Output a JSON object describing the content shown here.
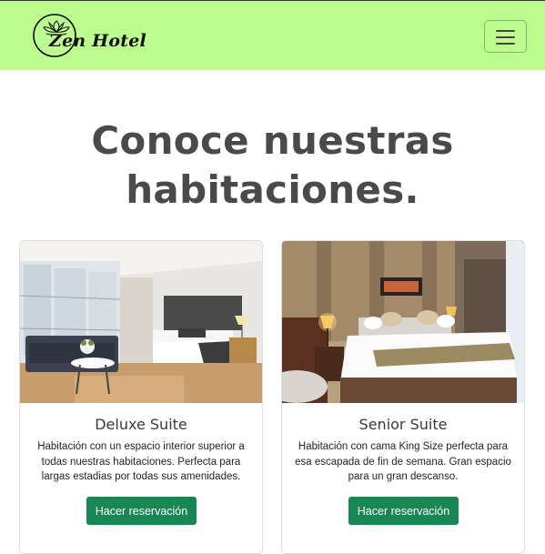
{
  "navbar": {
    "brand_name": "Zen Hotel",
    "logo_icon": "lotus-icon",
    "menu_icon": "hamburger-menu-icon",
    "background": "#bdfd8f"
  },
  "main": {
    "heading_line1": "Conoce nuestras",
    "heading_line2": "habitaciones."
  },
  "rooms": [
    {
      "title": "Deluxe Suite",
      "description": "Habitación con un espacio interior superior a todas nuestras habitaciones. Perfecta para largas estadias por todas sus amenidades.",
      "button_label": "Hacer reservación",
      "image": "bright-modern-hotel-room-photo"
    },
    {
      "title": "Senior Suite",
      "description": "Habitación con cama King Size perfecta para esa escapada de fin de semana. Gran espacio para un gran descanso.",
      "button_label": "Hacer reservación",
      "image": "warm-hotel-room-photo"
    }
  ],
  "colors": {
    "navbar_bg": "#bdfd8f",
    "button_bg": "#198754",
    "heading": "#4a4a4a"
  }
}
